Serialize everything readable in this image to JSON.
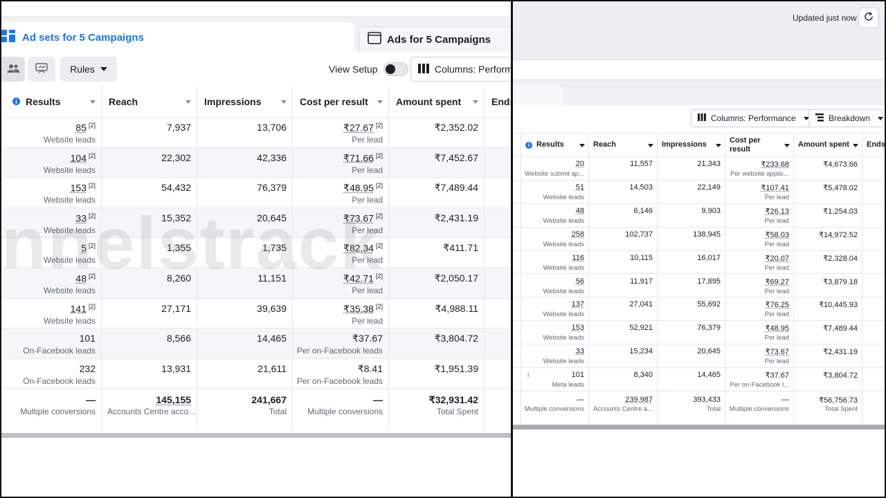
{
  "left": {
    "tabs": {
      "active": "Ad sets for 5 Campaigns",
      "inactive": "Ads for 5 Campaigns"
    },
    "toolbar": {
      "rules": "Rules",
      "view_setup": "View Setup",
      "columns": "Columns: Performa"
    },
    "watermark": "nnelstrack",
    "columns": [
      "Results",
      "Reach",
      "Impressions",
      "Cost per result",
      "Amount spent",
      "Ends"
    ],
    "rows": [
      {
        "results": "85",
        "results_sup": "[2]",
        "results_sub": "Website leads",
        "reach": "7,937",
        "impressions": "13,706",
        "cpr": "₹27.67",
        "cpr_sup": "[2]",
        "cpr_sub": "Per lead",
        "spent": "₹2,352.02"
      },
      {
        "results": "104",
        "results_sup": "[2]",
        "results_sub": "Website leads",
        "reach": "22,302",
        "impressions": "42,336",
        "cpr": "₹71.66",
        "cpr_sup": "[2]",
        "cpr_sub": "Per lead",
        "spent": "₹7,452.67"
      },
      {
        "results": "153",
        "results_sup": "[2]",
        "results_sub": "Website leads",
        "reach": "54,432",
        "impressions": "76,379",
        "cpr": "₹48.95",
        "cpr_sup": "[2]",
        "cpr_sub": "Per lead",
        "spent": "₹7,489.44"
      },
      {
        "results": "33",
        "results_sup": "[2]",
        "results_sub": "Website leads",
        "reach": "15,352",
        "impressions": "20,645",
        "cpr": "₹73.67",
        "cpr_sup": "[2]",
        "cpr_sub": "Per lead",
        "spent": "₹2,431.19"
      },
      {
        "results": "5",
        "results_sup": "[2]",
        "results_sub": "Website leads",
        "reach": "1,355",
        "impressions": "1,735",
        "cpr": "₹82.34",
        "cpr_sup": "[2]",
        "cpr_sub": "Per lead",
        "spent": "₹411.71"
      },
      {
        "results": "48",
        "results_sup": "[2]",
        "results_sub": "Website leads",
        "reach": "8,260",
        "impressions": "11,151",
        "cpr": "₹42.71",
        "cpr_sup": "[2]",
        "cpr_sub": "Per lead",
        "spent": "₹2,050.17"
      },
      {
        "results": "141",
        "results_sup": "[2]",
        "results_sub": "Website leads",
        "reach": "27,171",
        "impressions": "39,639",
        "cpr": "₹35.38",
        "cpr_sup": "[2]",
        "cpr_sub": "Per lead",
        "spent": "₹4,988.11"
      },
      {
        "results": "101",
        "results_sup": "",
        "results_sub": "On-Facebook leads",
        "reach": "8,566",
        "impressions": "14,465",
        "cpr": "₹37.67",
        "cpr_sup": "",
        "cpr_sub": "Per on-Facebook leads",
        "spent": "₹3,804.72"
      },
      {
        "results": "232",
        "results_sup": "",
        "results_sub": "On-Facebook leads",
        "reach": "13,931",
        "impressions": "21,611",
        "cpr": "₹8.41",
        "cpr_sup": "",
        "cpr_sub": "Per on-Facebook leads",
        "spent": "₹1,951.39"
      }
    ],
    "totals": {
      "results": "—",
      "results_sub": "Multiple conversions",
      "reach": "145,155",
      "reach_sub": "Accounts Centre acco...",
      "impressions": "241,667",
      "impressions_sub": "Total",
      "cpr": "—",
      "cpr_sub": "Multiple conversions",
      "spent": "₹32,931.42",
      "spent_sub": "Total Spent"
    }
  },
  "right": {
    "updated": "Updated just now",
    "toolbar": {
      "columns": "Columns: Performance",
      "breakdown": "Breakdown"
    },
    "columns": [
      "Results",
      "Reach",
      "Impressions",
      "Cost per result",
      "Amount spent",
      "Ends"
    ],
    "rows": [
      {
        "results": "20",
        "results_sub": "Website submit ap...",
        "reach": "11,557",
        "impressions": "21,343",
        "cpr": "₹233.68",
        "cpr_sub": "Per website applic...",
        "spent": "₹4,673.66"
      },
      {
        "results": "51",
        "results_sub": "Website leads",
        "reach": "14,503",
        "impressions": "22,149",
        "cpr": "₹107.41",
        "cpr_sub": "Per lead",
        "spent": "₹5,478.02"
      },
      {
        "results": "48",
        "results_sub": "Website leads",
        "reach": "6,146",
        "impressions": "9,903",
        "cpr": "₹26.13",
        "cpr_sub": "Per lead",
        "spent": "₹1,254.03"
      },
      {
        "results": "258",
        "results_sub": "Website leads",
        "reach": "102,737",
        "impressions": "138,945",
        "cpr": "₹58.03",
        "cpr_sub": "Per lead",
        "spent": "₹14,972.52"
      },
      {
        "results": "116",
        "results_sub": "Website leads",
        "reach": "10,115",
        "impressions": "16,017",
        "cpr": "₹20.07",
        "cpr_sub": "Per lead",
        "spent": "₹2,328.04"
      },
      {
        "results": "56",
        "results_sub": "Website leads",
        "reach": "11,917",
        "impressions": "17,895",
        "cpr": "₹69.27",
        "cpr_sub": "Per lead",
        "spent": "₹3,879.18"
      },
      {
        "results": "137",
        "results_sub": "Website leads",
        "reach": "27,041",
        "impressions": "55,692",
        "cpr": "₹76.25",
        "cpr_sub": "Per lead",
        "spent": "₹10,445.93"
      },
      {
        "results": "153",
        "results_sub": "Website leads",
        "reach": "52,921",
        "impressions": "76,379",
        "cpr": "₹48.95",
        "cpr_sub": "Per lead",
        "spent": "₹7,489.44"
      },
      {
        "results": "33",
        "results_sub": "Website leads",
        "reach": "15,234",
        "impressions": "20,645",
        "cpr": "₹73.67",
        "cpr_sub": "Per lead",
        "spent": "₹2,431.19"
      },
      {
        "results": "101",
        "results_sub": "Meta leads",
        "reach": "8,340",
        "impressions": "14,465",
        "cpr": "₹37.67",
        "cpr_sub": "Per on-Facebook l...",
        "spent": "₹3,804.72"
      }
    ],
    "totals": {
      "results": "—",
      "results_sub": "Multiple conversions",
      "reach": "239,987",
      "reach_sub": "Accounts Centre a...",
      "impressions": "393,433",
      "impressions_sub": "Total",
      "cpr": "—",
      "cpr_sub": "Multiple conversions",
      "spent": "₹56,756.73",
      "spent_sub": "Total Spent"
    }
  },
  "colors": {
    "accent": "#1877f2",
    "text": "#1c1e21",
    "muted": "#606770",
    "border": "#e4e6eb"
  },
  "icons": [
    "ad-sets-grid-icon",
    "ads-window-icon",
    "people-icon",
    "chart-switch-icon",
    "caret-down-icon",
    "columns-icon",
    "breakdown-icon",
    "refresh-icon",
    "info-icon",
    "download-icon"
  ]
}
